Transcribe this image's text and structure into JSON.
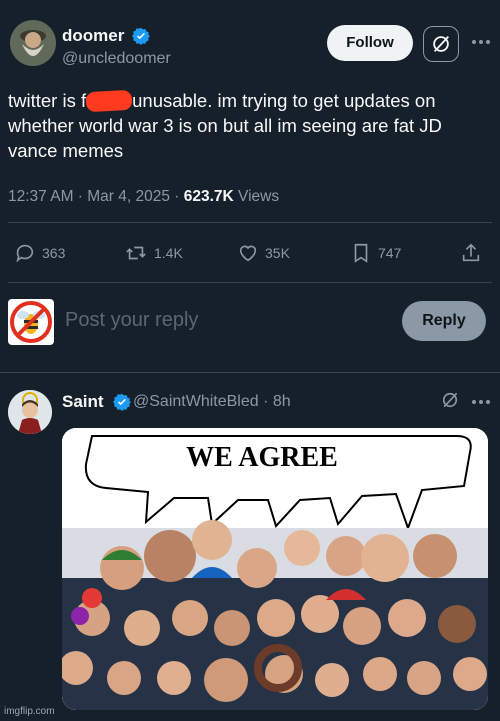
{
  "tweet": {
    "author": {
      "name": "doomer",
      "handle": "@uncledoomer"
    },
    "follow_label": "Follow",
    "text_before_redaction": "twitter is f",
    "text_after_redaction": "unusable. im trying to get updates on whether world war 3 is on but all im seeing are fat JD vance memes",
    "timestamp": "12:37 AM · Mar 4, 2025 · ",
    "views_count": "623.7K",
    "views_label": " Views",
    "actions": {
      "replies": "363",
      "reposts": "1.4K",
      "likes": "35K",
      "bookmarks": "747"
    }
  },
  "reply_box": {
    "placeholder": "Post your reply",
    "button_label": "Reply"
  },
  "reply": {
    "author": {
      "name": "Saint",
      "handle": "@SaintWhiteBled",
      "time": "· 8h"
    },
    "meme": {
      "caption": "WE AGREE"
    }
  },
  "watermark": "imgflip.com",
  "colors": {
    "background": "#15202b",
    "verified_blue": "#1d9bf0",
    "redaction_red": "#ff3b1f",
    "muted_text": "#8b98a5"
  }
}
